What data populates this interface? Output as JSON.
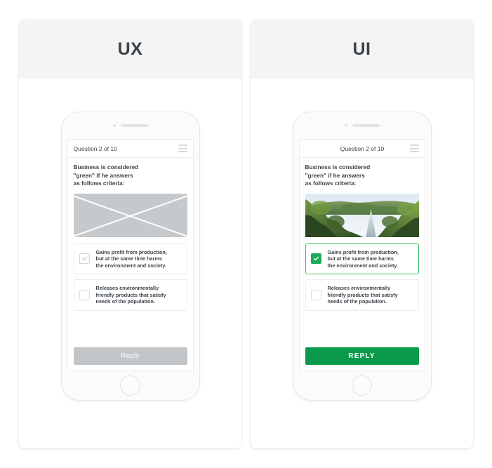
{
  "panels": [
    {
      "title": "UX",
      "phone": {
        "app_bar": {
          "title": "Question 2 of 10",
          "menu_icon": "hamburger-icon"
        },
        "question_lines": [
          "Business is considered",
          "\"green\" if he answers",
          "as follows criteria:"
        ],
        "media": {
          "kind": "image-placeholder",
          "placeholder_color": "#c6c9cb"
        },
        "options": [
          {
            "checked": true,
            "lines": [
              "Gains profit from production,",
              "but at the same time harms",
              "the environment and society."
            ]
          },
          {
            "checked": false,
            "lines": [
              "Releases environmentally",
              "friendly products that satisfy",
              "needs of the population."
            ]
          }
        ],
        "reply_label": "Reply"
      }
    },
    {
      "title": "UI",
      "phone": {
        "app_bar": {
          "title": "Question 2 of 10",
          "menu_icon": "hamburger-icon"
        },
        "question_lines": [
          "Business is considered",
          "\"green\" if he answers",
          "as follows criteria:"
        ],
        "media": {
          "kind": "photo",
          "description": "forest valley with river and hills"
        },
        "options": [
          {
            "checked": true,
            "lines": [
              "Gains profit from production,",
              "but at the same time harms",
              "the environment and society."
            ]
          },
          {
            "checked": false,
            "lines": [
              "Releases environmentally",
              "friendly products that satisfy",
              "needs of the population."
            ]
          }
        ],
        "reply_label": "REPLY"
      }
    }
  ],
  "colors": {
    "accent_green": "#089a4a",
    "checkbox_green": "#1aab55",
    "selected_border_green": "#3fc06b",
    "grey_button": "#c2c5c7",
    "placeholder_grey": "#c6c9cb",
    "panel_header_grey": "#f4f4f4",
    "text_dark": "#3d444b"
  }
}
